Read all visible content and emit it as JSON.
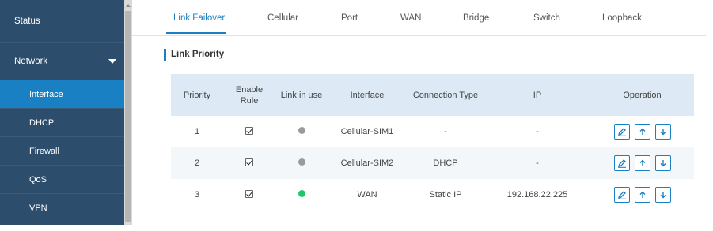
{
  "sidebar": {
    "status": "Status",
    "network": "Network",
    "items": [
      {
        "label": "Interface",
        "active": true
      },
      {
        "label": "DHCP",
        "active": false
      },
      {
        "label": "Firewall",
        "active": false
      },
      {
        "label": "QoS",
        "active": false
      },
      {
        "label": "VPN",
        "active": false
      }
    ]
  },
  "tabs": [
    "Link Failover",
    "Cellular",
    "Port",
    "WAN",
    "Bridge",
    "Switch",
    "Loopback"
  ],
  "active_tab": "Link Failover",
  "section_title": "Link Priority",
  "table": {
    "headers": [
      "Priority",
      "Enable Rule",
      "Link in use",
      "Interface",
      "Connection Type",
      "IP",
      "Operation"
    ],
    "rows": [
      {
        "priority": "1",
        "enable_rule": true,
        "link_status": "gray",
        "interface": "Cellular-SIM1",
        "connection_type": "-",
        "ip": "-"
      },
      {
        "priority": "2",
        "enable_rule": true,
        "link_status": "gray",
        "interface": "Cellular-SIM2",
        "connection_type": "DHCP",
        "ip": "-"
      },
      {
        "priority": "3",
        "enable_rule": true,
        "link_status": "green",
        "interface": "WAN",
        "connection_type": "Static IP",
        "ip": "192.168.22.225"
      }
    ],
    "operation_icons": [
      "edit-icon",
      "arrow-up-icon",
      "arrow-down-icon"
    ]
  },
  "colors": {
    "accent": "#1a80c4",
    "sidebar_bg": "#2c4d6b",
    "status_gray": "#9a9a9a",
    "status_green": "#1fc66a"
  }
}
